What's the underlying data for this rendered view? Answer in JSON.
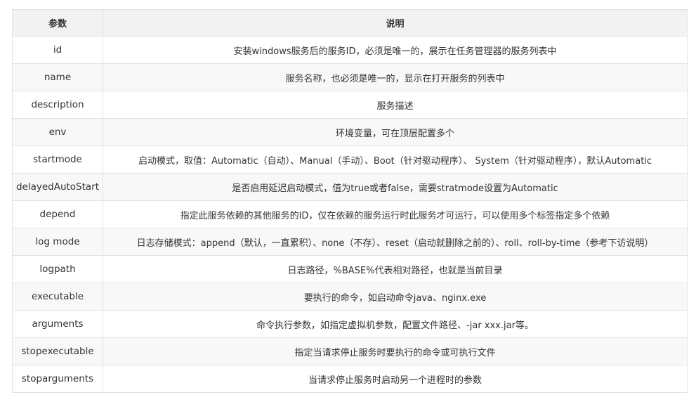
{
  "table": {
    "headers": [
      "参数",
      "说明"
    ],
    "rows": [
      {
        "param": "id",
        "desc": "安装windows服务后的服务ID，必须是唯一的，展示在任务管理器的服务列表中"
      },
      {
        "param": "name",
        "desc": "服务名称，也必须是唯一的，显示在打开服务的列表中"
      },
      {
        "param": "description",
        "desc": "服务描述"
      },
      {
        "param": "env",
        "desc": "环境变量，可在顶层配置多个"
      },
      {
        "param": "startmode",
        "desc": "启动模式，取值：Automatic（自动）、Manual（手动）、Boot（针对驱动程序）、 System（针对驱动程序），默认Automatic"
      },
      {
        "param": "delayedAutoStart",
        "desc": "是否启用延迟启动模式，值为true或者false，需要stratmode设置为Automatic"
      },
      {
        "param": "depend",
        "desc": "指定此服务依赖的其他服务的ID，仅在依赖的服务运行时此服务才可运行，可以使用多个标签指定多个依赖"
      },
      {
        "param": "log mode",
        "desc": "日志存储模式：append（默认，一直累积）、none（不存）、reset（启动就删除之前的）、roll、roll-by-time（参考下访说明）"
      },
      {
        "param": "logpath",
        "desc": "日志路径，%BASE%代表相对路径，也就是当前目录"
      },
      {
        "param": "executable",
        "desc": "要执行的命令，如启动命令java、nginx.exe"
      },
      {
        "param": "arguments",
        "desc": "命令执行参数，如指定虚拟机参数，配置文件路径、-jar xxx.jar等。"
      },
      {
        "param": "stopexecutable",
        "desc": "指定当请求停止服务时要执行的命令或可执行文件"
      },
      {
        "param": "stoparguments",
        "desc": "当请求停止服务时启动另一个进程时的参数"
      }
    ]
  }
}
